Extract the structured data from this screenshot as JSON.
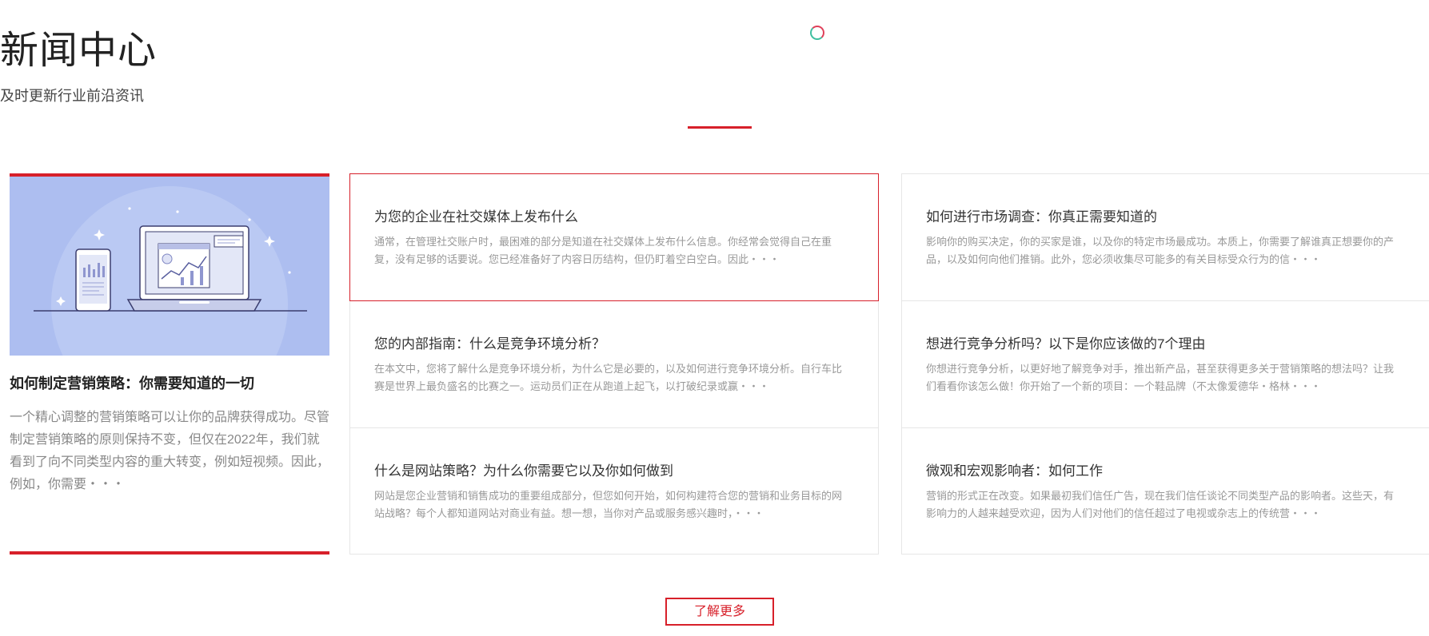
{
  "header": {
    "title": "新闻中心",
    "subtitle": "及时更新行业前沿资讯",
    "accent_color": "#d7202a"
  },
  "featured": {
    "title": "如何制定营销策略：你需要知道的一切",
    "summary": "一个精心调整的营销策略可以让你的品牌获得成功。尽管制定营销策略的原则保持不变，但仅在2022年，我们就看到了向不同类型内容的重大转变，例如短视频。因此，例如，你需要・・・",
    "image_icon": "laptop-phone-chart-illustration"
  },
  "articles": [
    {
      "title": "为您的企业在社交媒体上发布什么",
      "summary": "通常，在管理社交账户时，最困难的部分是知道在社交媒体上发布什么信息。你经常会觉得自己在重复，没有足够的话要说。您已经准备好了内容日历结构，但仍盯着空白空白。因此・・・"
    },
    {
      "title": "如何进行市场调查：你真正需要知道的",
      "summary": "影响你的购买决定，你的买家是谁，以及你的特定市场最成功。本质上，你需要了解谁真正想要你的产品，以及如何向他们推销。此外，您必须收集尽可能多的有关目标受众行为的信・・・"
    },
    {
      "title": "您的内部指南：什么是竞争环境分析？",
      "summary": "在本文中，您将了解什么是竞争环境分析，为什么它是必要的，以及如何进行竞争环境分析。自行车比赛是世界上最负盛名的比赛之一。运动员们正在从跑道上起飞，以打破纪录或赢・・・"
    },
    {
      "title": "想进行竞争分析吗？以下是你应该做的7个理由",
      "summary": "你想进行竞争分析，以更好地了解竞争对手，推出新产品，甚至获得更多关于营销策略的想法吗？让我们看看你该怎么做！你开始了一个新的项目：一个鞋品牌（不太像爱德华・格林・・・"
    },
    {
      "title": "什么是网站策略？为什么你需要它以及你如何做到",
      "summary": "网站是您企业营销和销售成功的重要组成部分，但您如何开始，如何构建符合您的营销和业务目标的网站战略？每个人都知道网站对商业有益。想一想，当你对产品或服务感兴趣时，・・・"
    },
    {
      "title": "微观和宏观影响者：如何工作",
      "summary": "营销的形式正在改变。如果最初我们信任广告，现在我们信任谈论不同类型产品的影响者。这些天，有影响力的人越来越受欢迎，因为人们对他们的信任超过了电视或杂志上的传统营・・・"
    }
  ],
  "more_button": {
    "label": "了解更多"
  },
  "icons": {
    "loader": "loading-spinner-icon"
  }
}
